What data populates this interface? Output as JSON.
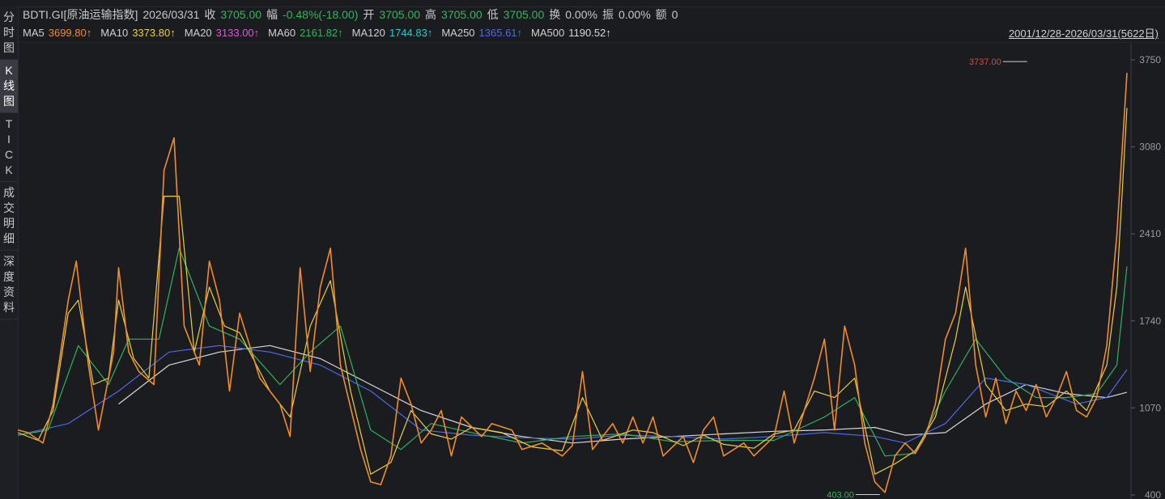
{
  "info": {
    "symbol": "BDTI.GI[原油运输指数]",
    "date": "2026/03/31",
    "close_label": "收",
    "close": "3705.00",
    "change_label": "幅",
    "change": "-0.48%(-18.00)",
    "open_label": "开",
    "open": "3705.00",
    "high_label": "高",
    "high": "3705.00",
    "low_label": "低",
    "low": "3705.00",
    "turnover_label": "换",
    "turnover": "0.00%",
    "amplitude_label": "振",
    "amplitude": "0.00%",
    "amount_label": "额",
    "amount": "0"
  },
  "ma": [
    {
      "label": "MA5",
      "value": "3699.80↑",
      "color": "#f08c2c"
    },
    {
      "label": "MA10",
      "value": "3373.80↑",
      "color": "#e8d040"
    },
    {
      "label": "MA20",
      "value": "3133.00↑",
      "color": "#d85ad8"
    },
    {
      "label": "MA60",
      "value": "2161.82↑",
      "color": "#2fb35a"
    },
    {
      "label": "MA120",
      "value": "1744.83↑",
      "color": "#25c8c8"
    },
    {
      "label": "MA250",
      "value": "1365.61↑",
      "color": "#4a6ae8"
    },
    {
      "label": "MA500",
      "value": "1190.52↑",
      "color": "#d8d8d8"
    }
  ],
  "date_range": "2001/12/28-2026/03/31(5622日)",
  "sidebar": [
    {
      "label": "分时图",
      "active": false
    },
    {
      "label": "K线图",
      "active": true
    },
    {
      "label": "TICK",
      "active": false
    },
    {
      "label": "成交明细",
      "active": false
    },
    {
      "label": "深度资料",
      "active": false
    }
  ],
  "chart_data": {
    "type": "line",
    "y_ticks": [
      "3750",
      "3080",
      "2410",
      "1740",
      "1070",
      "400"
    ],
    "ylim": [
      400,
      3750
    ],
    "x_range": [
      "2001/12/28",
      "2026/03/31"
    ],
    "annotations": {
      "max_label": "3737.00",
      "max_value": 3737,
      "max_t": 0.993,
      "min_label": "403.00",
      "min_value": 403,
      "min_t": 0.855
    },
    "series": [
      {
        "name": "MA5",
        "color": "#f08c2c",
        "points": [
          [
            0,
            900
          ],
          [
            0.01,
            880
          ],
          [
            0.025,
            800
          ],
          [
            0.035,
            1100
          ],
          [
            0.05,
            1900
          ],
          [
            0.058,
            2200
          ],
          [
            0.07,
            1400
          ],
          [
            0.08,
            900
          ],
          [
            0.095,
            1500
          ],
          [
            0.1,
            2150
          ],
          [
            0.11,
            1500
          ],
          [
            0.12,
            1350
          ],
          [
            0.135,
            1250
          ],
          [
            0.145,
            2900
          ],
          [
            0.155,
            3150
          ],
          [
            0.165,
            1700
          ],
          [
            0.18,
            1400
          ],
          [
            0.19,
            2200
          ],
          [
            0.2,
            1900
          ],
          [
            0.21,
            1200
          ],
          [
            0.22,
            1800
          ],
          [
            0.24,
            1300
          ],
          [
            0.26,
            1100
          ],
          [
            0.27,
            850
          ],
          [
            0.28,
            2150
          ],
          [
            0.29,
            1350
          ],
          [
            0.3,
            2000
          ],
          [
            0.31,
            2300
          ],
          [
            0.32,
            1400
          ],
          [
            0.34,
            750
          ],
          [
            0.35,
            500
          ],
          [
            0.36,
            480
          ],
          [
            0.37,
            700
          ],
          [
            0.38,
            1300
          ],
          [
            0.39,
            1100
          ],
          [
            0.4,
            800
          ],
          [
            0.41,
            900
          ],
          [
            0.42,
            1050
          ],
          [
            0.43,
            700
          ],
          [
            0.44,
            1000
          ],
          [
            0.46,
            850
          ],
          [
            0.47,
            950
          ],
          [
            0.49,
            900
          ],
          [
            0.5,
            750
          ],
          [
            0.52,
            800
          ],
          [
            0.54,
            700
          ],
          [
            0.55,
            780
          ],
          [
            0.56,
            1350
          ],
          [
            0.57,
            750
          ],
          [
            0.59,
            950
          ],
          [
            0.6,
            800
          ],
          [
            0.61,
            1000
          ],
          [
            0.62,
            800
          ],
          [
            0.63,
            1000
          ],
          [
            0.64,
            700
          ],
          [
            0.66,
            850
          ],
          [
            0.67,
            650
          ],
          [
            0.68,
            900
          ],
          [
            0.69,
            1000
          ],
          [
            0.7,
            700
          ],
          [
            0.72,
            800
          ],
          [
            0.73,
            700
          ],
          [
            0.75,
            850
          ],
          [
            0.76,
            1200
          ],
          [
            0.77,
            800
          ],
          [
            0.79,
            1300
          ],
          [
            0.8,
            1600
          ],
          [
            0.81,
            900
          ],
          [
            0.82,
            1700
          ],
          [
            0.83,
            1400
          ],
          [
            0.84,
            800
          ],
          [
            0.85,
            500
          ],
          [
            0.86,
            420
          ],
          [
            0.87,
            700
          ],
          [
            0.88,
            800
          ],
          [
            0.89,
            720
          ],
          [
            0.9,
            850
          ],
          [
            0.91,
            1100
          ],
          [
            0.92,
            1600
          ],
          [
            0.93,
            1800
          ],
          [
            0.94,
            2300
          ],
          [
            0.95,
            1400
          ],
          [
            0.96,
            1000
          ],
          [
            0.97,
            1300
          ],
          [
            0.98,
            950
          ],
          [
            0.99,
            1200
          ],
          [
            1.0,
            1050
          ],
          [
            1.01,
            1250
          ],
          [
            1.02,
            1000
          ],
          [
            1.03,
            1150
          ],
          [
            1.04,
            1350
          ],
          [
            1.05,
            1050
          ],
          [
            1.06,
            1000
          ],
          [
            1.07,
            1150
          ],
          [
            1.08,
            1550
          ],
          [
            1.09,
            2400
          ],
          [
            1.1,
            3650
          ]
        ]
      },
      {
        "name": "MA10",
        "color": "#e8d040",
        "points": [
          [
            0,
            880
          ],
          [
            0.02,
            820
          ],
          [
            0.035,
            1050
          ],
          [
            0.05,
            1800
          ],
          [
            0.06,
            1900
          ],
          [
            0.075,
            1250
          ],
          [
            0.09,
            1300
          ],
          [
            0.1,
            1900
          ],
          [
            0.115,
            1450
          ],
          [
            0.13,
            1300
          ],
          [
            0.145,
            2700
          ],
          [
            0.16,
            2700
          ],
          [
            0.175,
            1500
          ],
          [
            0.19,
            2000
          ],
          [
            0.205,
            1700
          ],
          [
            0.22,
            1650
          ],
          [
            0.25,
            1200
          ],
          [
            0.27,
            1000
          ],
          [
            0.29,
            1700
          ],
          [
            0.31,
            2050
          ],
          [
            0.33,
            1200
          ],
          [
            0.35,
            560
          ],
          [
            0.37,
            650
          ],
          [
            0.39,
            1050
          ],
          [
            0.41,
            870
          ],
          [
            0.43,
            830
          ],
          [
            0.45,
            920
          ],
          [
            0.48,
            880
          ],
          [
            0.51,
            770
          ],
          [
            0.54,
            740
          ],
          [
            0.56,
            1150
          ],
          [
            0.58,
            820
          ],
          [
            0.61,
            900
          ],
          [
            0.63,
            880
          ],
          [
            0.66,
            780
          ],
          [
            0.68,
            860
          ],
          [
            0.7,
            790
          ],
          [
            0.73,
            760
          ],
          [
            0.75,
            870
          ],
          [
            0.77,
            900
          ],
          [
            0.79,
            1200
          ],
          [
            0.81,
            1150
          ],
          [
            0.83,
            1300
          ],
          [
            0.85,
            560
          ],
          [
            0.87,
            640
          ],
          [
            0.89,
            740
          ],
          [
            0.91,
            1000
          ],
          [
            0.93,
            1600
          ],
          [
            0.94,
            2000
          ],
          [
            0.96,
            1250
          ],
          [
            0.98,
            1050
          ],
          [
            1.0,
            1100
          ],
          [
            1.02,
            1080
          ],
          [
            1.04,
            1200
          ],
          [
            1.06,
            1050
          ],
          [
            1.08,
            1400
          ],
          [
            1.09,
            2000
          ],
          [
            1.1,
            3380
          ]
        ]
      },
      {
        "name": "MA60",
        "color": "#2fb35a",
        "points": [
          [
            0,
            860
          ],
          [
            0.03,
            900
          ],
          [
            0.06,
            1550
          ],
          [
            0.09,
            1250
          ],
          [
            0.11,
            1600
          ],
          [
            0.14,
            1600
          ],
          [
            0.16,
            2300
          ],
          [
            0.19,
            1700
          ],
          [
            0.22,
            1600
          ],
          [
            0.26,
            1250
          ],
          [
            0.29,
            1500
          ],
          [
            0.32,
            1700
          ],
          [
            0.35,
            900
          ],
          [
            0.38,
            750
          ],
          [
            0.41,
            950
          ],
          [
            0.45,
            880
          ],
          [
            0.5,
            800
          ],
          [
            0.55,
            850
          ],
          [
            0.6,
            870
          ],
          [
            0.65,
            810
          ],
          [
            0.7,
            820
          ],
          [
            0.75,
            820
          ],
          [
            0.8,
            1000
          ],
          [
            0.83,
            1150
          ],
          [
            0.86,
            700
          ],
          [
            0.89,
            720
          ],
          [
            0.92,
            1200
          ],
          [
            0.95,
            1600
          ],
          [
            0.98,
            1300
          ],
          [
            1.01,
            1150
          ],
          [
            1.04,
            1150
          ],
          [
            1.07,
            1180
          ],
          [
            1.09,
            1400
          ],
          [
            1.1,
            2160
          ]
        ]
      },
      {
        "name": "MA250",
        "color": "#4a6ae8",
        "points": [
          [
            0,
            860
          ],
          [
            0.05,
            950
          ],
          [
            0.1,
            1200
          ],
          [
            0.15,
            1500
          ],
          [
            0.2,
            1550
          ],
          [
            0.25,
            1500
          ],
          [
            0.3,
            1400
          ],
          [
            0.35,
            1200
          ],
          [
            0.4,
            900
          ],
          [
            0.45,
            860
          ],
          [
            0.5,
            840
          ],
          [
            0.55,
            830
          ],
          [
            0.6,
            860
          ],
          [
            0.65,
            850
          ],
          [
            0.7,
            830
          ],
          [
            0.75,
            850
          ],
          [
            0.8,
            880
          ],
          [
            0.85,
            850
          ],
          [
            0.88,
            800
          ],
          [
            0.92,
            950
          ],
          [
            0.96,
            1300
          ],
          [
            1.0,
            1250
          ],
          [
            1.05,
            1100
          ],
          [
            1.08,
            1150
          ],
          [
            1.1,
            1365
          ]
        ]
      },
      {
        "name": "MA500",
        "color": "#d8d8d8",
        "points": [
          [
            0.1,
            1100
          ],
          [
            0.15,
            1400
          ],
          [
            0.2,
            1500
          ],
          [
            0.25,
            1550
          ],
          [
            0.3,
            1450
          ],
          [
            0.35,
            1250
          ],
          [
            0.4,
            1050
          ],
          [
            0.45,
            920
          ],
          [
            0.5,
            850
          ],
          [
            0.55,
            800
          ],
          [
            0.6,
            830
          ],
          [
            0.65,
            850
          ],
          [
            0.7,
            870
          ],
          [
            0.75,
            890
          ],
          [
            0.8,
            900
          ],
          [
            0.85,
            920
          ],
          [
            0.88,
            860
          ],
          [
            0.92,
            880
          ],
          [
            0.96,
            1100
          ],
          [
            1.0,
            1250
          ],
          [
            1.04,
            1180
          ],
          [
            1.08,
            1150
          ],
          [
            1.1,
            1190
          ]
        ]
      }
    ]
  }
}
